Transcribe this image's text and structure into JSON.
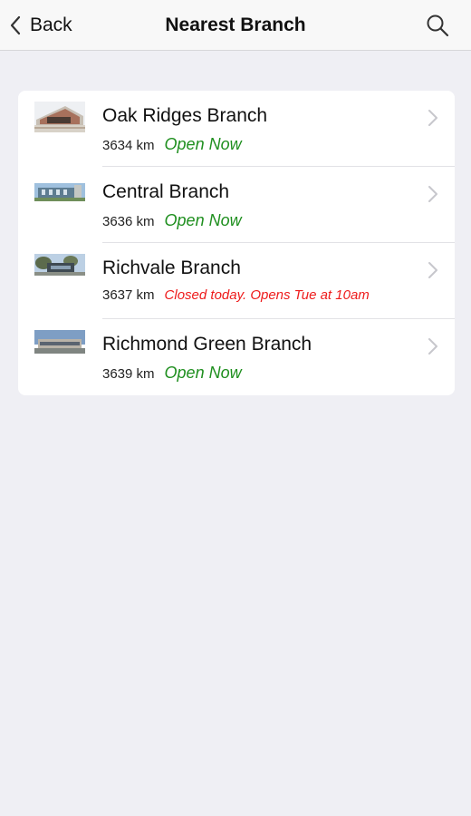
{
  "nav": {
    "back_label": "Back",
    "title": "Nearest Branch",
    "search_icon": "search-icon"
  },
  "branches": [
    {
      "name": "Oak Ridges Branch",
      "distance": "3634 km",
      "status": "Open Now",
      "status_type": "open"
    },
    {
      "name": "Central Branch",
      "distance": "3636 km",
      "status": "Open Now",
      "status_type": "open"
    },
    {
      "name": "Richvale Branch",
      "distance": "3637 km",
      "status": "Closed today. Opens Tue at 10am",
      "status_type": "closed"
    },
    {
      "name": "Richmond Green Branch",
      "distance": "3639 km",
      "status": "Open Now",
      "status_type": "open"
    }
  ],
  "colors": {
    "background": "#efeff4",
    "open": "#1f8f1f",
    "closed": "#ee1c1c",
    "chevron": "#c7c7cc"
  }
}
